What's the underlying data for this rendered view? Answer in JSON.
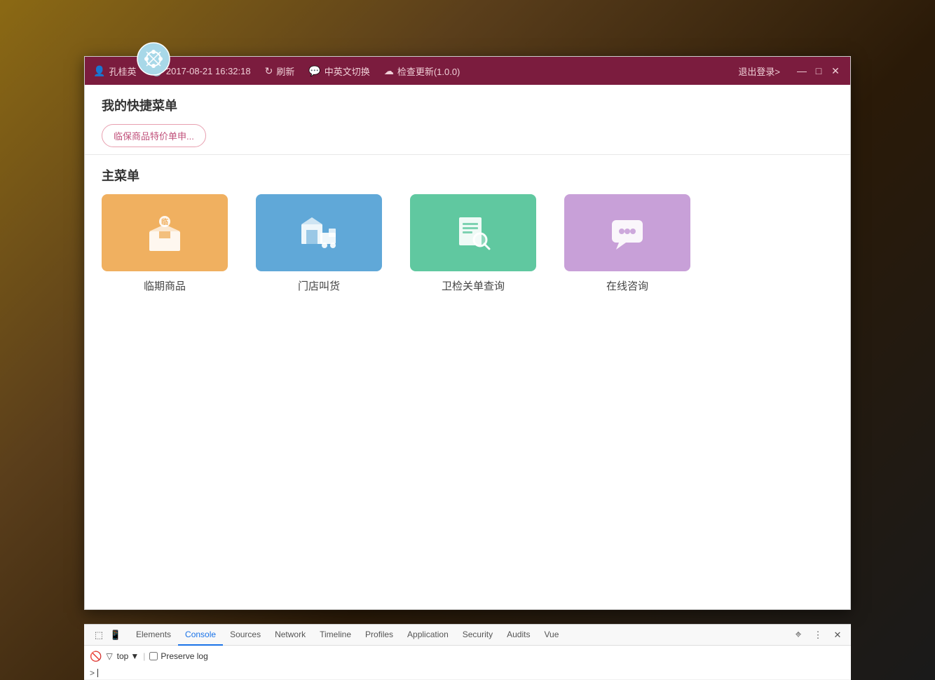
{
  "background": {
    "description": "blurred desk background"
  },
  "logo": {
    "alt": "app-logo"
  },
  "titlebar": {
    "user_icon": "👤",
    "username": "孔桂英",
    "time_icon": "🕐",
    "datetime": "2017-08-21 16:32:18",
    "refresh_icon": "🔄",
    "refresh_label": "刷新",
    "lang_icon": "💬",
    "lang_label": "中英文切换",
    "update_icon": "☁",
    "update_label": "检查更新(1.0.0)",
    "logout_label": "退出登录>",
    "minimize_label": "—",
    "maximize_label": "□",
    "close_label": "✕"
  },
  "quick_menu": {
    "title": "我的快捷菜单",
    "shortcut_btn_label": "临保商品特价单申..."
  },
  "main_menu": {
    "title": "主菜单",
    "items": [
      {
        "id": "linqi",
        "label": "临期商品",
        "color_class": "box-orange",
        "icon": "box"
      },
      {
        "id": "mendian",
        "label": "门店叫货",
        "color_class": "box-blue",
        "icon": "truck"
      },
      {
        "id": "weijian",
        "label": "卫检关单查询",
        "color_class": "box-green",
        "icon": "search-doc"
      },
      {
        "id": "zaixian",
        "label": "在线咨询",
        "color_class": "box-purple",
        "icon": "chat"
      }
    ]
  },
  "devtools": {
    "tabs": [
      {
        "label": "Elements",
        "active": false
      },
      {
        "label": "Console",
        "active": true
      },
      {
        "label": "Sources",
        "active": false
      },
      {
        "label": "Network",
        "active": false
      },
      {
        "label": "Timeline",
        "active": false
      },
      {
        "label": "Profiles",
        "active": false
      },
      {
        "label": "Application",
        "active": false
      },
      {
        "label": "Security",
        "active": false
      },
      {
        "label": "Audits",
        "active": false
      },
      {
        "label": "Vue",
        "active": false
      }
    ],
    "console_bar": {
      "filter_placeholder": "",
      "context_label": "top",
      "preserve_log_label": "Preserve log"
    },
    "cursor_line": ">"
  }
}
